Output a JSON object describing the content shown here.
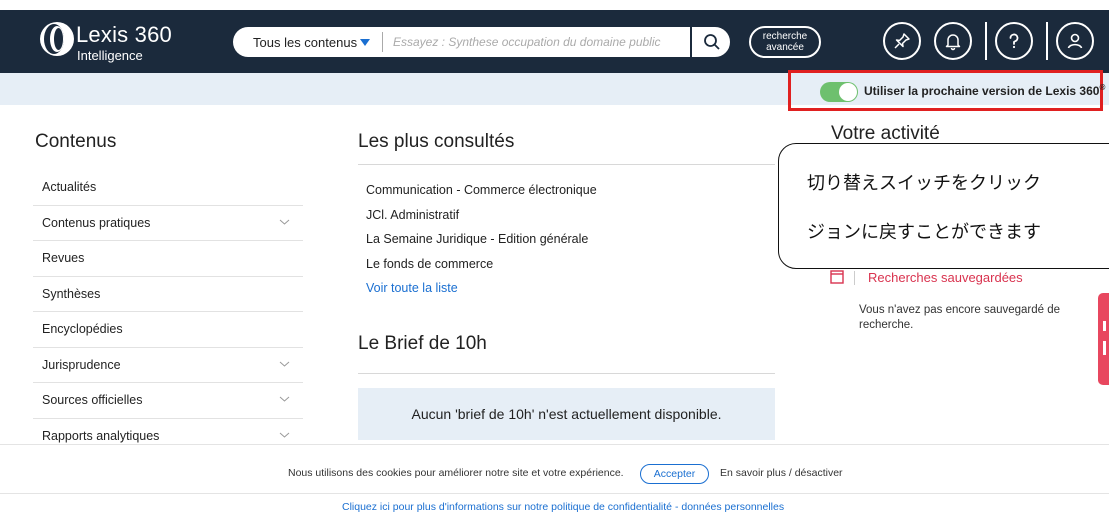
{
  "header": {
    "logo_title": "Lexis 360",
    "logo_subtitle": "Intelligence",
    "scope_label": "Tous les contenus",
    "search_placeholder": "Essayez : Synthese occupation du domaine public",
    "advanced_search_line1": "recherche",
    "advanced_search_line2": "avancée",
    "icons": [
      "pin-icon",
      "bell-icon",
      "help-icon",
      "user-icon"
    ],
    "bg_color": "#1b2a3c"
  },
  "version_toggle": {
    "label": "Utiliser la prochaine version de Lexis 360",
    "trademark": "®",
    "state": "on",
    "toggle_color": "#6ec06e",
    "highlight_color": "#e02020"
  },
  "contents": {
    "title": "Contenus",
    "items": [
      {
        "label": "Actualités",
        "expandable": false
      },
      {
        "label": "Contenus pratiques",
        "expandable": true
      },
      {
        "label": "Revues",
        "expandable": false
      },
      {
        "label": "Synthèses",
        "expandable": false
      },
      {
        "label": "Encyclopédies",
        "expandable": false
      },
      {
        "label": "Jurisprudence",
        "expandable": true
      },
      {
        "label": "Sources officielles",
        "expandable": true
      },
      {
        "label": "Rapports analytiques",
        "expandable": true
      }
    ]
  },
  "popular": {
    "title": "Les plus consultés",
    "items": [
      "Communication - Commerce électronique",
      "JCl. Administratif",
      "La Semaine Juridique - Edition générale",
      "Le fonds de commerce"
    ],
    "see_all": "Voir toute la liste"
  },
  "brief": {
    "title": "Le Brief de 10h",
    "empty_message": "Aucun 'brief de 10h' n'est actuellement disponible."
  },
  "activity": {
    "title": "Votre activité",
    "saved_searches_title": "Recherches sauvegardées",
    "saved_searches_empty": "Vous n'avez pas encore sauvegardé de recherche.",
    "accent_color": "#d9334f"
  },
  "callout": {
    "line1": "切り替えスイッチをクリック",
    "line2": "ジョンに戻すことができます"
  },
  "cookie": {
    "message": "Nous utilisons des cookies pour améliorer notre site et votre expérience.",
    "accept_label": "Accepter",
    "more_label": "En savoir plus / désactiver",
    "policy_link": "Cliquez ici pour plus d'informations sur notre politique de confidentialité - données personnelles"
  }
}
